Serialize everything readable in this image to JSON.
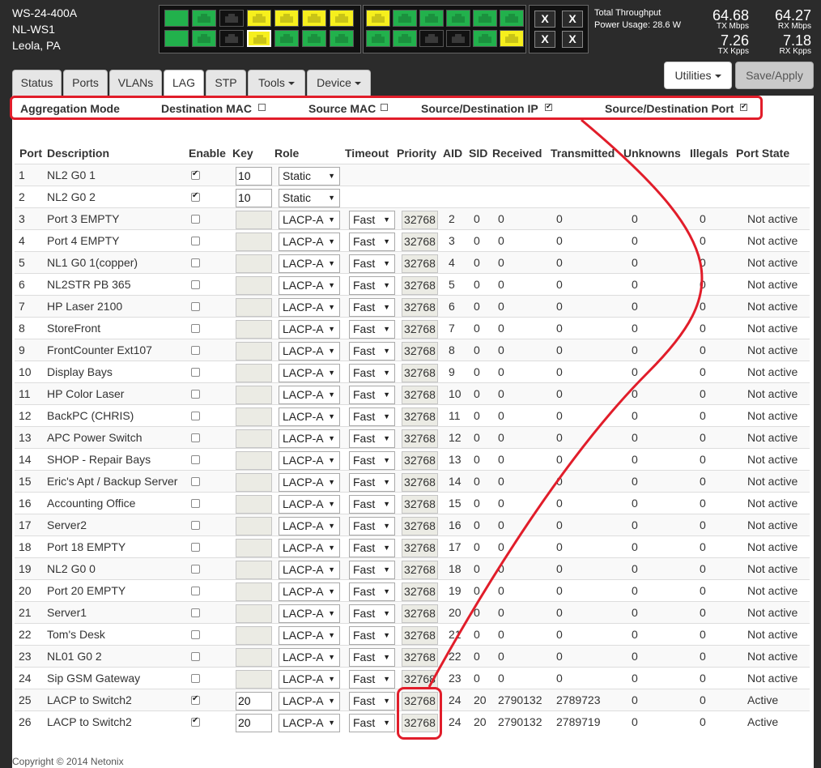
{
  "device": {
    "model": "WS-24-400A",
    "name": "NL-WS1",
    "location": "Leola, PA"
  },
  "throughput": {
    "total_label": "Total Throughput",
    "power_label": "Power Usage: 28.6 W",
    "tx_mbps": "64.68",
    "tx_mbps_unit": "TX Mbps",
    "rx_mbps": "64.27",
    "rx_mbps_unit": "RX Mbps",
    "tx_kpps": "7.26",
    "tx_kpps_unit": "TX Kpps",
    "rx_kpps": "7.18",
    "rx_kpps_unit": "RX Kpps"
  },
  "port_panel": {
    "group1_top": [
      "sfp",
      "green",
      "black",
      "yellow",
      "yellow",
      "yellow",
      "yellow"
    ],
    "group1_bottom": [
      "sfp",
      "green",
      "black",
      "yellow-selected",
      "green",
      "green",
      "green"
    ],
    "group2_top": [
      "yellow",
      "green",
      "green",
      "green",
      "green",
      "green"
    ],
    "group2_bottom": [
      "green",
      "green",
      "black",
      "black",
      "green",
      "yellow"
    ],
    "uplinks": [
      "X",
      "X",
      "X",
      "X"
    ]
  },
  "tabs": [
    {
      "label": "Status"
    },
    {
      "label": "Ports"
    },
    {
      "label": "VLANs"
    },
    {
      "label": "LAG"
    },
    {
      "label": "STP"
    },
    {
      "label": "Tools"
    },
    {
      "label": "Device"
    }
  ],
  "buttons": {
    "utilities": "Utilities",
    "save": "Save/Apply"
  },
  "aggregation": {
    "title": "Aggregation Mode",
    "options": [
      {
        "label": "Destination MAC",
        "checked": false
      },
      {
        "label": "Source MAC",
        "checked": false
      },
      {
        "label": "Source/Destination IP",
        "checked": true
      },
      {
        "label": "Source/Destination Port",
        "checked": true
      }
    ]
  },
  "table": {
    "headers": [
      "Port",
      "Description",
      "Enable",
      "Key",
      "Role",
      "Timeout",
      "Priority",
      "AID",
      "SID",
      "Received",
      "Transmitted",
      "Unknowns",
      "Illegals",
      "Port State"
    ],
    "rows": [
      {
        "port": "1",
        "desc": "NL2 G0 1",
        "enable": true,
        "key": "10",
        "role": "Static",
        "timeout": "",
        "priority": "",
        "aid": "",
        "sid": "",
        "rx": "",
        "tx": "",
        "unk": "",
        "ill": "",
        "state": ""
      },
      {
        "port": "2",
        "desc": "NL2 G0 2",
        "enable": true,
        "key": "10",
        "role": "Static",
        "timeout": "",
        "priority": "",
        "aid": "",
        "sid": "",
        "rx": "",
        "tx": "",
        "unk": "",
        "ill": "",
        "state": ""
      },
      {
        "port": "3",
        "desc": "Port 3 EMPTY",
        "enable": false,
        "key": "",
        "role": "LACP-A",
        "timeout": "Fast",
        "priority": "32768",
        "aid": "2",
        "sid": "0",
        "rx": "0",
        "tx": "0",
        "unk": "0",
        "ill": "0",
        "state": "Not active"
      },
      {
        "port": "4",
        "desc": "Port 4 EMPTY",
        "enable": false,
        "key": "",
        "role": "LACP-A",
        "timeout": "Fast",
        "priority": "32768",
        "aid": "3",
        "sid": "0",
        "rx": "0",
        "tx": "0",
        "unk": "0",
        "ill": "0",
        "state": "Not active"
      },
      {
        "port": "5",
        "desc": "NL1 G0 1(copper)",
        "enable": false,
        "key": "",
        "role": "LACP-A",
        "timeout": "Fast",
        "priority": "32768",
        "aid": "4",
        "sid": "0",
        "rx": "0",
        "tx": "0",
        "unk": "0",
        "ill": "0",
        "state": "Not active"
      },
      {
        "port": "6",
        "desc": "NL2STR PB 365",
        "enable": false,
        "key": "",
        "role": "LACP-A",
        "timeout": "Fast",
        "priority": "32768",
        "aid": "5",
        "sid": "0",
        "rx": "0",
        "tx": "0",
        "unk": "0",
        "ill": "0",
        "state": "Not active"
      },
      {
        "port": "7",
        "desc": "HP Laser 2100",
        "enable": false,
        "key": "",
        "role": "LACP-A",
        "timeout": "Fast",
        "priority": "32768",
        "aid": "6",
        "sid": "0",
        "rx": "0",
        "tx": "0",
        "unk": "0",
        "ill": "0",
        "state": "Not active"
      },
      {
        "port": "8",
        "desc": "StoreFront",
        "enable": false,
        "key": "",
        "role": "LACP-A",
        "timeout": "Fast",
        "priority": "32768",
        "aid": "7",
        "sid": "0",
        "rx": "0",
        "tx": "0",
        "unk": "0",
        "ill": "0",
        "state": "Not active"
      },
      {
        "port": "9",
        "desc": "FrontCounter Ext107",
        "enable": false,
        "key": "",
        "role": "LACP-A",
        "timeout": "Fast",
        "priority": "32768",
        "aid": "8",
        "sid": "0",
        "rx": "0",
        "tx": "0",
        "unk": "0",
        "ill": "0",
        "state": "Not active"
      },
      {
        "port": "10",
        "desc": "Display Bays",
        "enable": false,
        "key": "",
        "role": "LACP-A",
        "timeout": "Fast",
        "priority": "32768",
        "aid": "9",
        "sid": "0",
        "rx": "0",
        "tx": "0",
        "unk": "0",
        "ill": "0",
        "state": "Not active"
      },
      {
        "port": "11",
        "desc": "HP Color Laser",
        "enable": false,
        "key": "",
        "role": "LACP-A",
        "timeout": "Fast",
        "priority": "32768",
        "aid": "10",
        "sid": "0",
        "rx": "0",
        "tx": "0",
        "unk": "0",
        "ill": "0",
        "state": "Not active"
      },
      {
        "port": "12",
        "desc": "BackPC (CHRIS)",
        "enable": false,
        "key": "",
        "role": "LACP-A",
        "timeout": "Fast",
        "priority": "32768",
        "aid": "11",
        "sid": "0",
        "rx": "0",
        "tx": "0",
        "unk": "0",
        "ill": "0",
        "state": "Not active"
      },
      {
        "port": "13",
        "desc": "APC Power Switch",
        "enable": false,
        "key": "",
        "role": "LACP-A",
        "timeout": "Fast",
        "priority": "32768",
        "aid": "12",
        "sid": "0",
        "rx": "0",
        "tx": "0",
        "unk": "0",
        "ill": "0",
        "state": "Not active"
      },
      {
        "port": "14",
        "desc": "SHOP - Repair Bays",
        "enable": false,
        "key": "",
        "role": "LACP-A",
        "timeout": "Fast",
        "priority": "32768",
        "aid": "13",
        "sid": "0",
        "rx": "0",
        "tx": "0",
        "unk": "0",
        "ill": "0",
        "state": "Not active"
      },
      {
        "port": "15",
        "desc": "Eric's Apt / Backup Server",
        "enable": false,
        "key": "",
        "role": "LACP-A",
        "timeout": "Fast",
        "priority": "32768",
        "aid": "14",
        "sid": "0",
        "rx": "0",
        "tx": "0",
        "unk": "0",
        "ill": "0",
        "state": "Not active"
      },
      {
        "port": "16",
        "desc": "Accounting Office",
        "enable": false,
        "key": "",
        "role": "LACP-A",
        "timeout": "Fast",
        "priority": "32768",
        "aid": "15",
        "sid": "0",
        "rx": "0",
        "tx": "0",
        "unk": "0",
        "ill": "0",
        "state": "Not active"
      },
      {
        "port": "17",
        "desc": "Server2",
        "enable": false,
        "key": "",
        "role": "LACP-A",
        "timeout": "Fast",
        "priority": "32768",
        "aid": "16",
        "sid": "0",
        "rx": "0",
        "tx": "0",
        "unk": "0",
        "ill": "0",
        "state": "Not active"
      },
      {
        "port": "18",
        "desc": "Port 18 EMPTY",
        "enable": false,
        "key": "",
        "role": "LACP-A",
        "timeout": "Fast",
        "priority": "32768",
        "aid": "17",
        "sid": "0",
        "rx": "0",
        "tx": "0",
        "unk": "0",
        "ill": "0",
        "state": "Not active"
      },
      {
        "port": "19",
        "desc": "NL2 G0 0",
        "enable": false,
        "key": "",
        "role": "LACP-A",
        "timeout": "Fast",
        "priority": "32768",
        "aid": "18",
        "sid": "0",
        "rx": "0",
        "tx": "0",
        "unk": "0",
        "ill": "0",
        "state": "Not active"
      },
      {
        "port": "20",
        "desc": "Port 20 EMPTY",
        "enable": false,
        "key": "",
        "role": "LACP-A",
        "timeout": "Fast",
        "priority": "32768",
        "aid": "19",
        "sid": "0",
        "rx": "0",
        "tx": "0",
        "unk": "0",
        "ill": "0",
        "state": "Not active"
      },
      {
        "port": "21",
        "desc": "Server1",
        "enable": false,
        "key": "",
        "role": "LACP-A",
        "timeout": "Fast",
        "priority": "32768",
        "aid": "20",
        "sid": "0",
        "rx": "0",
        "tx": "0",
        "unk": "0",
        "ill": "0",
        "state": "Not active"
      },
      {
        "port": "22",
        "desc": "Tom's Desk",
        "enable": false,
        "key": "",
        "role": "LACP-A",
        "timeout": "Fast",
        "priority": "32768",
        "aid": "21",
        "sid": "0",
        "rx": "0",
        "tx": "0",
        "unk": "0",
        "ill": "0",
        "state": "Not active"
      },
      {
        "port": "23",
        "desc": "NL01 G0 2",
        "enable": false,
        "key": "",
        "role": "LACP-A",
        "timeout": "Fast",
        "priority": "32768",
        "aid": "22",
        "sid": "0",
        "rx": "0",
        "tx": "0",
        "unk": "0",
        "ill": "0",
        "state": "Not active"
      },
      {
        "port": "24",
        "desc": "Sip GSM Gateway",
        "enable": false,
        "key": "",
        "role": "LACP-A",
        "timeout": "Fast",
        "priority": "32768",
        "aid": "23",
        "sid": "0",
        "rx": "0",
        "tx": "0",
        "unk": "0",
        "ill": "0",
        "state": "Not active"
      },
      {
        "port": "25",
        "desc": "LACP to Switch2",
        "enable": true,
        "key": "20",
        "role": "LACP-A",
        "timeout": "Fast",
        "priority": "32768",
        "aid": "24",
        "sid": "20",
        "rx": "2790132",
        "tx": "2789723",
        "unk": "0",
        "ill": "0",
        "state": "Active"
      },
      {
        "port": "26",
        "desc": "LACP to Switch2",
        "enable": true,
        "key": "20",
        "role": "LACP-A",
        "timeout": "Fast",
        "priority": "32768",
        "aid": "24",
        "sid": "20",
        "rx": "2790132",
        "tx": "2789719",
        "unk": "0",
        "ill": "0",
        "state": "Active"
      }
    ]
  },
  "footer": "Copyright © 2014 Netonix",
  "colors": {
    "highlight": "#e11d2a",
    "port_green": "#22b14c",
    "port_yellow": "#f6ef1d",
    "header_bg": "#2b2b2b"
  }
}
